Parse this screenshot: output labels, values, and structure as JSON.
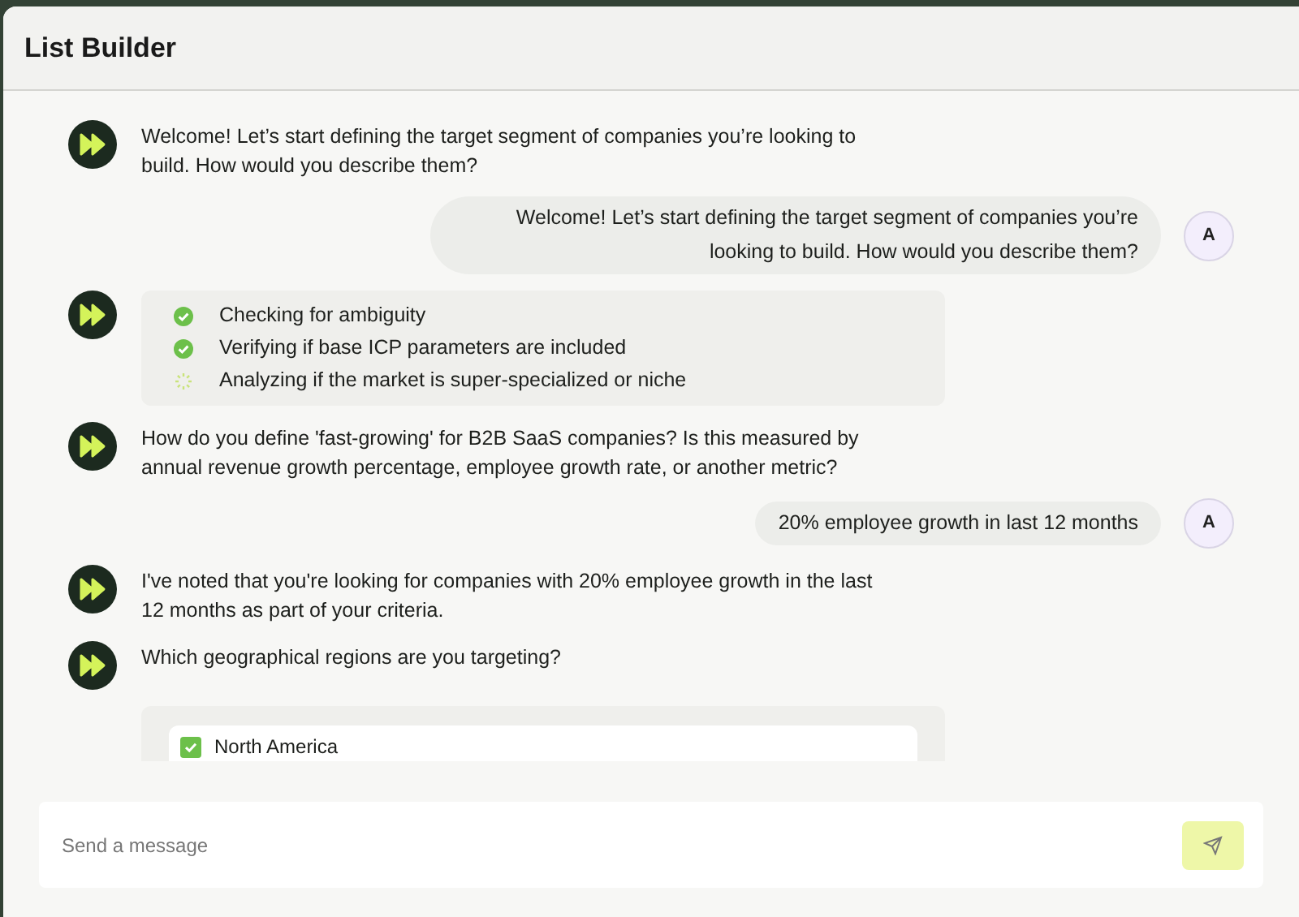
{
  "window": {
    "title": "List Builder"
  },
  "messages": [
    {
      "kind": "bot",
      "text": "Welcome! Let’s start defining the target segment of companies you’re looking to build. How would you describe them?"
    },
    {
      "kind": "user",
      "avatar": "A",
      "text": "Welcome! Let’s start defining the target segment of companies you’re looking to build. How would you describe them?"
    },
    {
      "kind": "steps",
      "steps": [
        {
          "text": "Checking for ambiguity",
          "done": true
        },
        {
          "text": "Verifying if base ICP parameters are included",
          "done": true
        },
        {
          "text": "Analyzing if the market is super-specialized or niche",
          "done": false
        }
      ]
    },
    {
      "kind": "bot",
      "text": "How do you define 'fast-growing' for B2B SaaS companies? Is this measured by annual revenue growth percentage, employee growth rate, or another metric?"
    },
    {
      "kind": "user",
      "avatar": "A",
      "text": "20% employee growth in last 12 months"
    },
    {
      "kind": "bot",
      "text": "I've noted that you're looking for companies with 20% employee growth in the last 12 months as part of your criteria."
    },
    {
      "kind": "bot",
      "text": "Which geographical regions are you targeting?"
    },
    {
      "kind": "options",
      "options": [
        {
          "label": "North America",
          "checked": true
        }
      ]
    }
  ],
  "composer": {
    "placeholder": "Send a message"
  }
}
